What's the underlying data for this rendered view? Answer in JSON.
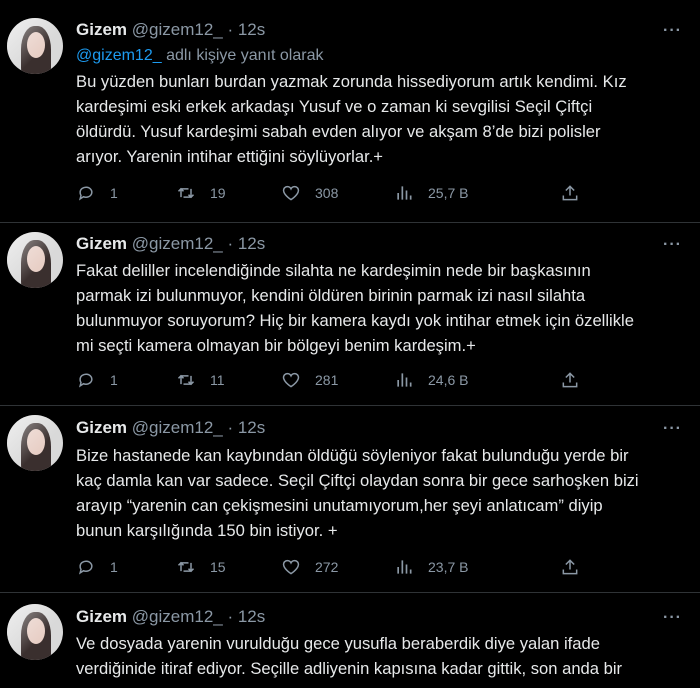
{
  "tweets": [
    {
      "name": "Gizem",
      "handle": "@gizem12_",
      "time": "12s",
      "reply_mention": "@gizem12_",
      "reply_text": " adlı kişiye yanıt olarak",
      "lines": [
        "Bu yüzden bunları burdan yazmak zorunda hissediyorum artık kendimi. Kız",
        "kardeşimi eski erkek arkadaşı Yusuf ve o zaman ki sevgilisi Seçil Çiftçi",
        "öldürdü. Yusuf kardeşimi sabah evden alıyor ve akşam 8’de bizi polisler",
        "arıyor. Yarenin intihar ettiğini söylüyorlar.+"
      ],
      "replies": "1",
      "retweets": "19",
      "likes": "308",
      "views": "25,7 B"
    },
    {
      "name": "Gizem",
      "handle": "@gizem12_",
      "time": "12s",
      "lines": [
        "Fakat deliller incelendiğinde silahta ne kardeşimin nede bir başkasının",
        "parmak izi bulunmuyor, kendini öldüren birinin parmak izi nasıl silahta",
        "bulunmuyor soruyorum? Hiç bir kamera kaydı yok intihar etmek için özellikle",
        "mi seçti kamera olmayan bir bölgeyi benim kardeşim.+"
      ],
      "replies": "1",
      "retweets": "11",
      "likes": "281",
      "views": "24,6 B"
    },
    {
      "name": "Gizem",
      "handle": "@gizem12_",
      "time": "12s",
      "lines": [
        "Bize hastanede kan kaybından öldüğü söyleniyor fakat bulunduğu yerde bir",
        "kaç damla kan var sadece. Seçil Çiftçi olaydan sonra bir gece sarhoşken bizi",
        "arayıp “yarenin can çekişmesini unutamıyorum,her şeyi anlatıcam” diyip",
        "bunun karşılığında 150 bin istiyor. +"
      ],
      "replies": "1",
      "retweets": "15",
      "likes": "272",
      "views": "23,7 B"
    },
    {
      "name": "Gizem",
      "handle": "@gizem12_",
      "time": "12s",
      "lines": [
        "Ve dosyada yarenin vurulduğu gece yusufla beraberdik diye yalan ifade",
        "verdiğinide itiraf ediyor. Seçille adliyenin kapısına kadar gittik, son anda bir"
      ]
    }
  ],
  "separator": " · ",
  "more_glyph": "···"
}
